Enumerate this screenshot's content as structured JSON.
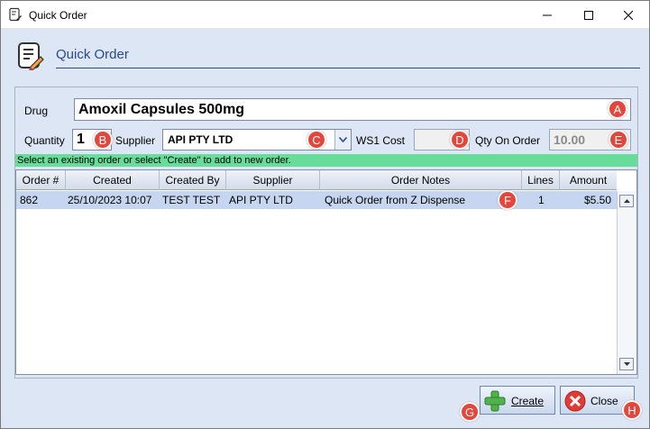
{
  "window": {
    "title": "Quick Order"
  },
  "header": {
    "title": "Quick Order"
  },
  "form": {
    "drug_label": "Drug",
    "drug_value": "Amoxil Capsules 500mg",
    "quantity_label": "Quantity",
    "quantity_value": "1",
    "supplier_label": "Supplier",
    "supplier_value": "API PTY LTD",
    "ws1_label": "WS1 Cost",
    "ws1_value": "",
    "qoo_label": "Qty On Order",
    "qoo_value": "10.00"
  },
  "hint": "Select an existing order or select \"Create\" to add to new order.",
  "grid": {
    "columns": [
      "Order #",
      "Created",
      "Created By",
      "Supplier",
      "Order Notes",
      "Lines",
      "Amount"
    ],
    "rows": [
      [
        "862",
        "25/10/2023 10:07",
        "TEST TEST",
        "API PTY LTD",
        "Quick Order from Z Dispense",
        "1",
        "$5.50"
      ]
    ]
  },
  "buttons": {
    "create": "Create",
    "close": "Close"
  },
  "markers": [
    "A",
    "B",
    "C",
    "D",
    "E",
    "F",
    "G",
    "H"
  ],
  "colors": {
    "accent": "#2a4a8a",
    "hint_bar": "#66dd99",
    "marker": "#e4463c",
    "selected_row": "#c6d6f0"
  }
}
